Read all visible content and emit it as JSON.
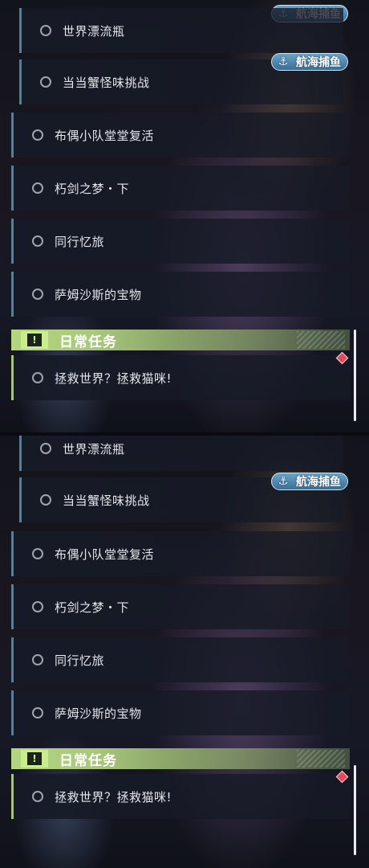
{
  "quests": {
    "world_bottle": "世界漂流瓶",
    "crab_challenge": "当当蟹怪味挑战",
    "doll_squad": "布偶小队堂堂复活",
    "rotten_sword": "朽剑之梦・下",
    "journey": "同行忆旅",
    "sams_treasure": "萨姆沙斯的宝物",
    "save_world": "拯救世界？拯救猫咪!"
  },
  "tag_label": "航海捕鱼",
  "daily_header": "日常任务",
  "header_icon": "!",
  "colors": {
    "main_bar": "#5e7d93",
    "daily_bar": "#a7c27a",
    "header_green": "#b3d67f",
    "tag_blue": "#4f86ad",
    "alert_red": "#e24a5a"
  },
  "icons": [
    "anchor-icon",
    "exclamation-icon",
    "alert-diamond-icon",
    "quest-ring-icon"
  ]
}
